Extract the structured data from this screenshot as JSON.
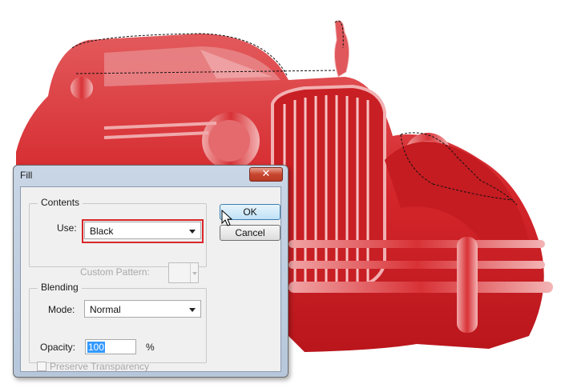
{
  "dialog": {
    "title": "Fill",
    "close_glyph": "✕",
    "ok_label": "OK",
    "cancel_label": "Cancel"
  },
  "contents": {
    "group_label": "Contents",
    "use_label": "Use:",
    "use_value": "Black",
    "custom_pattern_label": "Custom Pattern:"
  },
  "blending": {
    "group_label": "Blending",
    "mode_label": "Mode:",
    "mode_value": "Normal",
    "opacity_label": "Opacity:",
    "opacity_value": "100",
    "opacity_unit": "%",
    "preserve_transparency_label": "Preserve Transparency",
    "preserve_transparency_checked": false
  },
  "colors": {
    "car_overlay": "#d6262a",
    "highlight": "#d9262a",
    "text_selection": "#3399ff",
    "close_button": "#c8452e"
  },
  "icons": [
    "close-icon",
    "dropdown-caret-icon",
    "arrow-cursor-icon"
  ]
}
